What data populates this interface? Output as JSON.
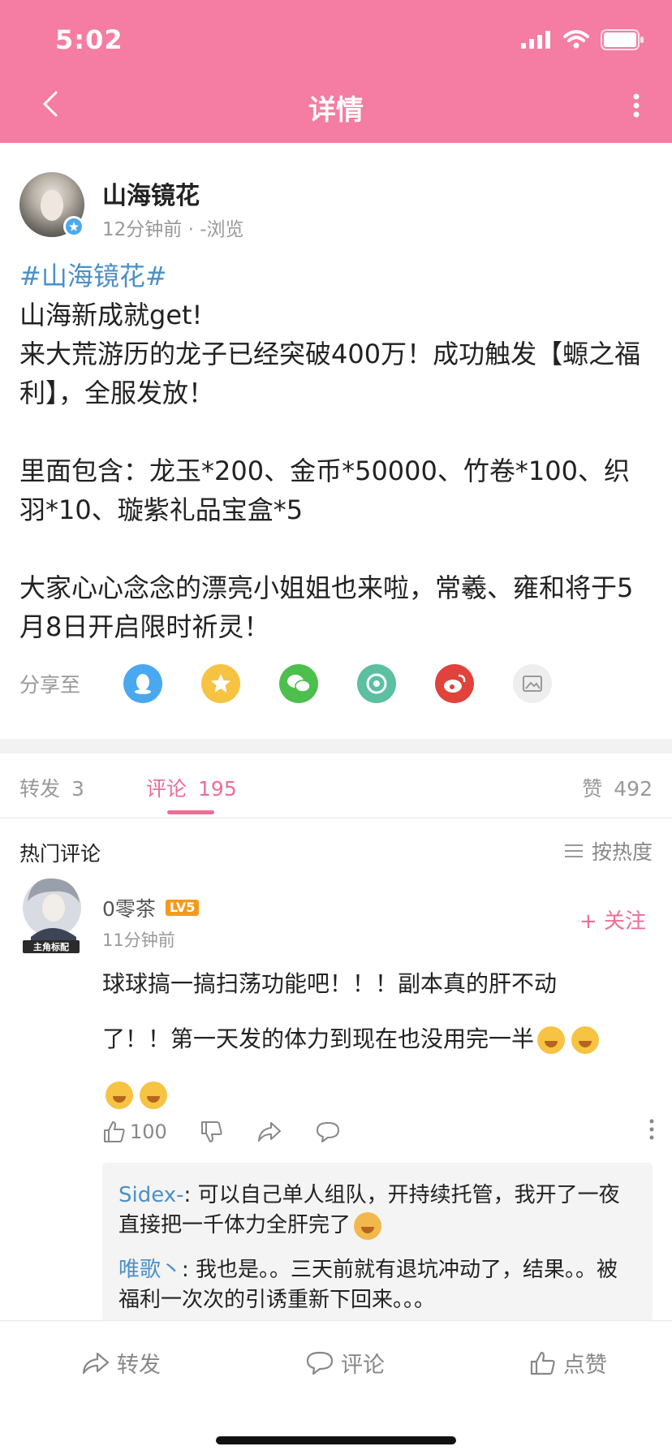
{
  "status_bar": {
    "time": "5:02"
  },
  "nav": {
    "title": "详情",
    "back_icon": "chevron-left-icon",
    "more_icon": "more-vertical-icon"
  },
  "post": {
    "author": "山海镜花",
    "meta": "12分钟前 · -浏览",
    "hashtag": "#山海镜花#",
    "lines": [
      "山海新成就get!",
      "来大荒游历的龙子已经突破400万！成功触发【螈之福利】，全服发放！",
      "",
      "里面包含：龙玉*200、金币*50000、竹卷*100、织羽*10、璇紫礼品宝盒*5",
      "",
      "大家心心念念的漂亮小姐姐也来啦，常羲、雍和将于5月8日开启限时祈灵！"
    ],
    "share_label": "分享至",
    "share_targets": [
      {
        "name": "qq-icon",
        "color": "#4aa8f0"
      },
      {
        "name": "qzone-icon",
        "color": "#f6c343"
      },
      {
        "name": "wechat-icon",
        "color": "#4cbf4c"
      },
      {
        "name": "moments-icon",
        "color": "#5cbfa0"
      },
      {
        "name": "weibo-icon",
        "color": "#e0433b"
      },
      {
        "name": "save-image-icon",
        "color": "#eeeeee"
      }
    ]
  },
  "tabs": {
    "repost_label": "转发",
    "repost_count": "3",
    "comment_label": "评论",
    "comment_count": "195",
    "like_label": "赞",
    "like_count": "492"
  },
  "comments": {
    "section_title": "热门评论",
    "sort_label": "按热度",
    "items": [
      {
        "user": "0零茶",
        "level": "LV5",
        "time": "11分钟前",
        "follow_label": "+ 关注",
        "text_line1": "球球搞一搞扫荡功能吧！！！副本真的肝不动",
        "text_line2": "了！！第一天发的体力到现在也没用完一半",
        "likes": "100",
        "avatar_caption": "主角标配"
      }
    ],
    "replies": [
      {
        "user": "Sidex-",
        "sep": ": ",
        "text": "可以自己单人组队，开持续托管，我开了一夜直接把一千体力全肝完了"
      },
      {
        "user": "唯歌丶",
        "sep": ": ",
        "text": "我也是。。三天前就有退坑冲动了，结果。。被福利一次次的引诱重新下回来。。。"
      }
    ]
  },
  "bottom_bar": {
    "repost": "转发",
    "comment": "评论",
    "like": "点赞"
  }
}
